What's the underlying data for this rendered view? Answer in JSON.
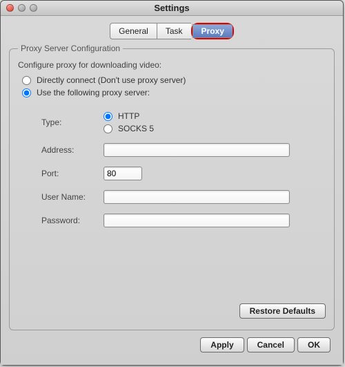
{
  "window": {
    "title": "Settings"
  },
  "tabs": {
    "general": "General",
    "task": "Task",
    "proxy": "Proxy",
    "active": "proxy"
  },
  "group": {
    "legend": "Proxy Server Configuration",
    "desc": "Configure proxy for downloading video:",
    "opt_direct": "Directly connect (Don't use proxy server)",
    "opt_useproxy": "Use the following proxy server:",
    "selected": "useproxy"
  },
  "proxy": {
    "type_label": "Type:",
    "type_http": "HTTP",
    "type_socks5": "SOCKS 5",
    "type_selected": "http",
    "address_label": "Address:",
    "address_value": "",
    "port_label": "Port:",
    "port_value": "80",
    "username_label": "User Name:",
    "username_value": "",
    "password_label": "Password:",
    "password_value": ""
  },
  "buttons": {
    "restore": "Restore Defaults",
    "apply": "Apply",
    "cancel": "Cancel",
    "ok": "OK"
  }
}
